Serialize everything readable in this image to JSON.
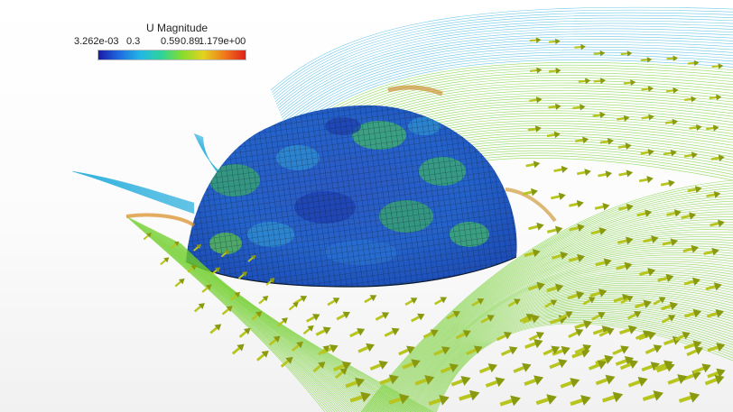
{
  "colorbar": {
    "title": "U Magnitude",
    "min_label": "3.262e-03",
    "ticks": [
      "0.3",
      "0.59",
      "0.89"
    ],
    "max_label": "1.179e+00",
    "colors": [
      "#1a1aa8",
      "#1f6be0",
      "#22b8e6",
      "#2ed39a",
      "#86dc2c",
      "#e3d21f",
      "#f07a1c",
      "#e0201a"
    ]
  },
  "scene_colors": {
    "streamline_fast": "#6fcf2a",
    "streamline_slow": "#3ab5e0",
    "arrow": "#b7c51e",
    "arrow_dark": "#8a9a10",
    "dome_base": "#2a63c8",
    "dome_patch": "#43b56a",
    "mesh_line": "#0b1a2e"
  }
}
